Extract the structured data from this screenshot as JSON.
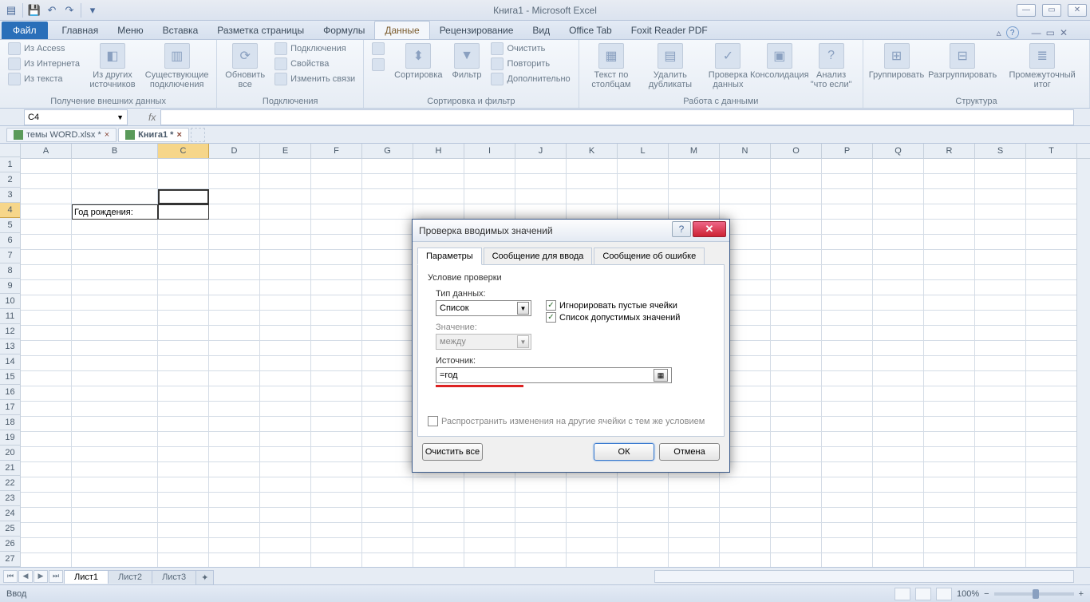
{
  "title": "Книга1 - Microsoft Excel",
  "tabs": {
    "file": "Файл",
    "items": [
      "Главная",
      "Меню",
      "Вставка",
      "Разметка страницы",
      "Формулы",
      "Данные",
      "Рецензирование",
      "Вид",
      "Office Tab",
      "Foxit Reader PDF"
    ],
    "active": "Данные"
  },
  "ribbon": {
    "g1": {
      "label": "Получение внешних данных",
      "access": "Из Access",
      "web": "Из Интернета",
      "text": "Из текста",
      "other": "Из других\nисточников",
      "existing": "Существующие\nподключения"
    },
    "g2": {
      "label": "Подключения",
      "refresh": "Обновить\nвсе",
      "conn": "Подключения",
      "prop": "Свойства",
      "edit": "Изменить связи"
    },
    "g3": {
      "label": "Сортировка и фильтр",
      "sort": "Сортировка",
      "filter": "Фильтр",
      "clear": "Очистить",
      "reapply": "Повторить",
      "adv": "Дополнительно"
    },
    "g4": {
      "label": "Работа с данными",
      "ttc": "Текст по\nстолбцам",
      "dup": "Удалить\nдубликаты",
      "val": "Проверка\nданных",
      "cons": "Консолидация",
      "what": "Анализ\n\"что если\""
    },
    "g5": {
      "label": "Структура",
      "group": "Группировать",
      "ungroup": "Разгруппировать",
      "sub": "Промежуточный\nитог"
    }
  },
  "namebox": "C4",
  "doctabs": {
    "t1": "темы WORD.xlsx *",
    "t2": "Книга1 *"
  },
  "columns": [
    "A",
    "B",
    "C",
    "D",
    "E",
    "F",
    "G",
    "H",
    "I",
    "J",
    "K",
    "L",
    "M",
    "N",
    "O",
    "P",
    "Q",
    "R",
    "S",
    "T"
  ],
  "rows_count": 27,
  "cellB4": "Год рождения:",
  "sheets": [
    "Лист1",
    "Лист2",
    "Лист3"
  ],
  "status": {
    "left": "Ввод",
    "zoom": "100%"
  },
  "dialog": {
    "title": "Проверка вводимых значений",
    "tabs": [
      "Параметры",
      "Сообщение для ввода",
      "Сообщение об ошибке"
    ],
    "section": "Условие проверки",
    "type_label": "Тип данных:",
    "type_value": "Список",
    "ignore": "Игнорировать пустые ячейки",
    "dropdown": "Список допустимых значений",
    "value_label": "Значение:",
    "value_value": "между",
    "source_label": "Источник:",
    "source_value": "=год",
    "propagate": "Распространить изменения на другие ячейки с тем же условием",
    "clear": "Очистить все",
    "ok": "ОК",
    "cancel": "Отмена"
  }
}
